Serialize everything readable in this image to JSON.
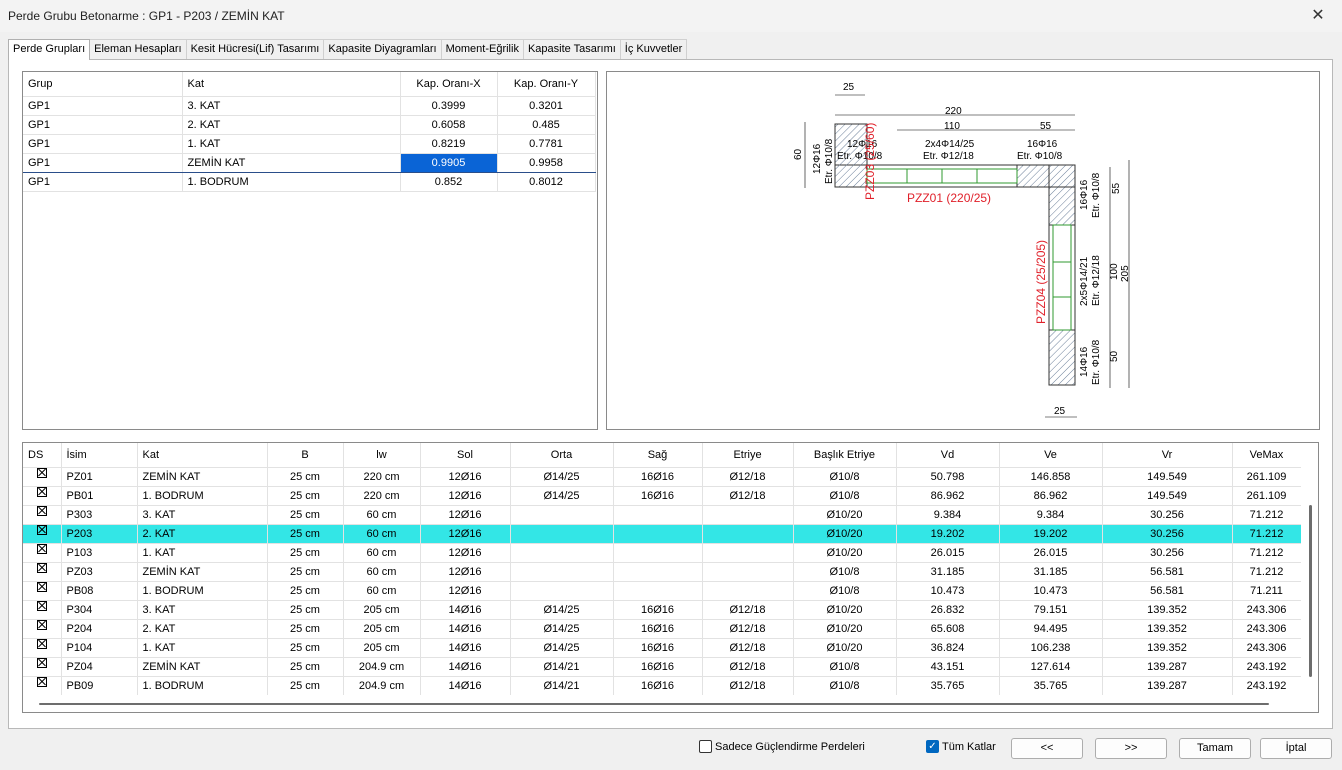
{
  "window": {
    "title": "Perde Grubu Betonarme  :  GP1 - P203 / ZEMİN KAT"
  },
  "tabs": [
    "Perde Grupları",
    "Eleman Hesapları",
    "Kesit Hücresi(Lif) Tasarımı",
    "Kapasite Diyagramları",
    "Moment-Eğrilik",
    "Kapasite Tasarımı",
    "İç Kuvvetler"
  ],
  "group_table": {
    "headers": [
      "Grup",
      "Kat",
      "Kap. Oranı-X",
      "Kap. Oranı-Y"
    ],
    "rows": [
      [
        "GP1",
        "3. KAT",
        "0.3999",
        "0.3201"
      ],
      [
        "GP1",
        "2. KAT",
        "0.6058",
        "0.485"
      ],
      [
        "GP1",
        "1. KAT",
        "0.8219",
        "0.7781"
      ],
      [
        "GP1",
        "ZEMİN KAT",
        "0.9905",
        "0.9958"
      ],
      [
        "GP1",
        "1. BODRUM",
        "0.852",
        "0.8012"
      ]
    ]
  },
  "drawing": {
    "dims": [
      "25",
      "220",
      "110",
      "55",
      "60",
      "205",
      "55",
      "100",
      "50",
      "25"
    ],
    "rebars": {
      "left": [
        "12Φ16",
        "Etr. Φ10/8"
      ],
      "left_top": [
        "12Φ16",
        "Etr. Φ10/8"
      ],
      "mid": [
        "2x4Φ14/25",
        "Etr. Φ12/18"
      ],
      "right": [
        "16Φ16",
        "Etr. Φ10/8"
      ],
      "vert_top": [
        "16Φ16",
        "Etr. Φ10/8"
      ],
      "vert_mid": [
        "2x5Φ14/21",
        "Etr. Φ12/18"
      ],
      "vert_bot": [
        "14Φ16",
        "Etr. Φ10/8"
      ]
    },
    "labels": [
      "PZZ01 (220/25)",
      "PZZ04 (25/205)",
      "PZZ03 (25/60)"
    ]
  },
  "elements_table": {
    "headers": [
      "DS",
      "İsim",
      "Kat",
      "B",
      "lw",
      "Sol",
      "Orta",
      "Sağ",
      "Etriye",
      "Başlık Etriye",
      "Vd",
      "Ve",
      "Vr",
      "VeMax"
    ],
    "rows": [
      [
        "PZ01",
        "ZEMİN KAT",
        "25 cm",
        "220 cm",
        "12Ø16",
        "Ø14/25",
        "16Ø16",
        "Ø12/18",
        "Ø10/8",
        "50.798",
        "146.858",
        "149.549",
        "261.109"
      ],
      [
        "PB01",
        "1. BODRUM",
        "25 cm",
        "220 cm",
        "12Ø16",
        "Ø14/25",
        "16Ø16",
        "Ø12/18",
        "Ø10/8",
        "86.962",
        "86.962",
        "149.549",
        "261.109"
      ],
      [
        "P303",
        "3. KAT",
        "25 cm",
        "60 cm",
        "12Ø16",
        "",
        "",
        "",
        "Ø10/20",
        "9.384",
        "9.384",
        "30.256",
        "71.212"
      ],
      [
        "P203",
        "2. KAT",
        "25 cm",
        "60 cm",
        "12Ø16",
        "",
        "",
        "",
        "Ø10/20",
        "19.202",
        "19.202",
        "30.256",
        "71.212"
      ],
      [
        "P103",
        "1. KAT",
        "25 cm",
        "60 cm",
        "12Ø16",
        "",
        "",
        "",
        "Ø10/20",
        "26.015",
        "26.015",
        "30.256",
        "71.212"
      ],
      [
        "PZ03",
        "ZEMİN KAT",
        "25 cm",
        "60 cm",
        "12Ø16",
        "",
        "",
        "",
        "Ø10/8",
        "31.185",
        "31.185",
        "56.581",
        "71.212"
      ],
      [
        "PB08",
        "1. BODRUM",
        "25 cm",
        "60 cm",
        "12Ø16",
        "",
        "",
        "",
        "Ø10/8",
        "10.473",
        "10.473",
        "56.581",
        "71.211"
      ],
      [
        "P304",
        "3. KAT",
        "25 cm",
        "205 cm",
        "14Ø16",
        "Ø14/25",
        "16Ø16",
        "Ø12/18",
        "Ø10/20",
        "26.832",
        "79.151",
        "139.352",
        "243.306"
      ],
      [
        "P204",
        "2. KAT",
        "25 cm",
        "205 cm",
        "14Ø16",
        "Ø14/25",
        "16Ø16",
        "Ø12/18",
        "Ø10/20",
        "65.608",
        "94.495",
        "139.352",
        "243.306"
      ],
      [
        "P104",
        "1. KAT",
        "25 cm",
        "205 cm",
        "14Ø16",
        "Ø14/25",
        "16Ø16",
        "Ø12/18",
        "Ø10/20",
        "36.824",
        "106.238",
        "139.352",
        "243.306"
      ],
      [
        "PZ04",
        "ZEMİN KAT",
        "25 cm",
        "204.9 cm",
        "14Ø16",
        "Ø14/21",
        "16Ø16",
        "Ø12/18",
        "Ø10/8",
        "43.151",
        "127.614",
        "139.287",
        "243.192"
      ],
      [
        "PB09",
        "1. BODRUM",
        "25 cm",
        "204.9 cm",
        "14Ø16",
        "Ø14/21",
        "16Ø16",
        "Ø12/18",
        "Ø10/8",
        "35.765",
        "35.765",
        "139.287",
        "243.192"
      ]
    ]
  },
  "footer": {
    "only_strengthening": "Sadece Güçlendirme Perdeleri",
    "all_floors": "Tüm Katlar",
    "prev": "<<",
    "next": ">>",
    "ok": "Tamam",
    "cancel": "İptal"
  }
}
